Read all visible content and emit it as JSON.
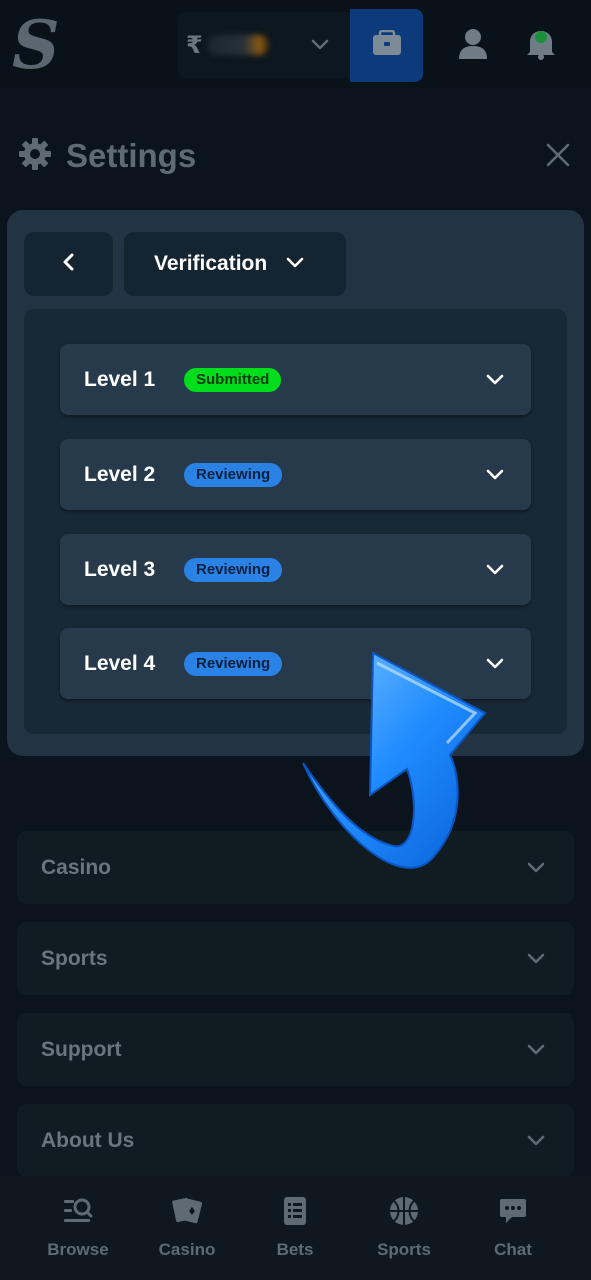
{
  "header": {
    "logo_letter": "S",
    "currency_symbol": "₹",
    "icons": [
      "chevron-down-icon",
      "wallet-icon",
      "user-icon",
      "bell-icon"
    ]
  },
  "settings": {
    "title": "Settings",
    "icons": [
      "gear-icon",
      "close-icon"
    ]
  },
  "panel": {
    "dropdown_label": "Verification",
    "levels": [
      {
        "name": "Level 1",
        "status": "Submitted"
      },
      {
        "name": "Level 2",
        "status": "Reviewing"
      },
      {
        "name": "Level 3",
        "status": "Reviewing"
      },
      {
        "name": "Level 4",
        "status": "Reviewing"
      }
    ]
  },
  "accordion": [
    {
      "label": "Casino"
    },
    {
      "label": "Sports"
    },
    {
      "label": "Support"
    },
    {
      "label": "About Us"
    }
  ],
  "bottom_nav": [
    {
      "label": "Browse",
      "icon": "search-list-icon"
    },
    {
      "label": "Casino",
      "icon": "cards-icon"
    },
    {
      "label": "Bets",
      "icon": "bet-slip-icon"
    },
    {
      "label": "Sports",
      "icon": "basketball-icon"
    },
    {
      "label": "Chat",
      "icon": "chat-icon"
    }
  ],
  "colors": {
    "background": "#0b141c",
    "panel": "#223444",
    "submitted_badge": "#00dd1a",
    "reviewing_badge": "#2a82e4",
    "wallet_button": "#0c3a7a",
    "arrow": "#1f8bff"
  }
}
